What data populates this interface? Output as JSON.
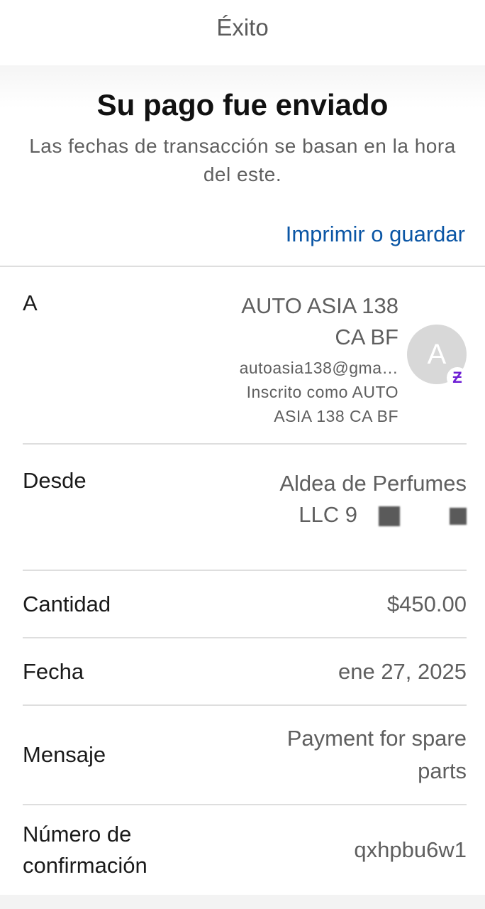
{
  "header": {
    "title": "Éxito"
  },
  "success": {
    "headline": "Su pago fue enviado",
    "subtitle": "Las fechas de transacción se basan en la hora del este.",
    "print_link": "Imprimir o guardar"
  },
  "recipient": {
    "label": "A",
    "name_line1": "AUTO ASIA 138",
    "name_line2": "CA BF",
    "email": "autoasia138@gma…",
    "registered_line1": "Inscrito como AUTO",
    "registered_line2": "ASIA 138 CA BF",
    "avatar_initial": "A",
    "badge_glyph": "Ƶ",
    "badge_icon": "zelle-icon",
    "badge_color": "#6d1ed4"
  },
  "from": {
    "label": "Desde",
    "line1": "Aldea de Perfumes",
    "line2": "LLC 9"
  },
  "details": {
    "amount_label": "Cantidad",
    "amount_value": "$450.00",
    "date_label": "Fecha",
    "date_value": "ene 27, 2025",
    "message_label": "Mensaje",
    "message_line1": "Payment for spare",
    "message_line2": "parts",
    "confirmation_label_line1": "Número de",
    "confirmation_label_line2": "confirmación",
    "confirmation_value": "qxhpbu6w1"
  },
  "colors": {
    "link": "#0b56a5",
    "divider": "#dedede",
    "secondary_text": "#5f5f5f"
  }
}
